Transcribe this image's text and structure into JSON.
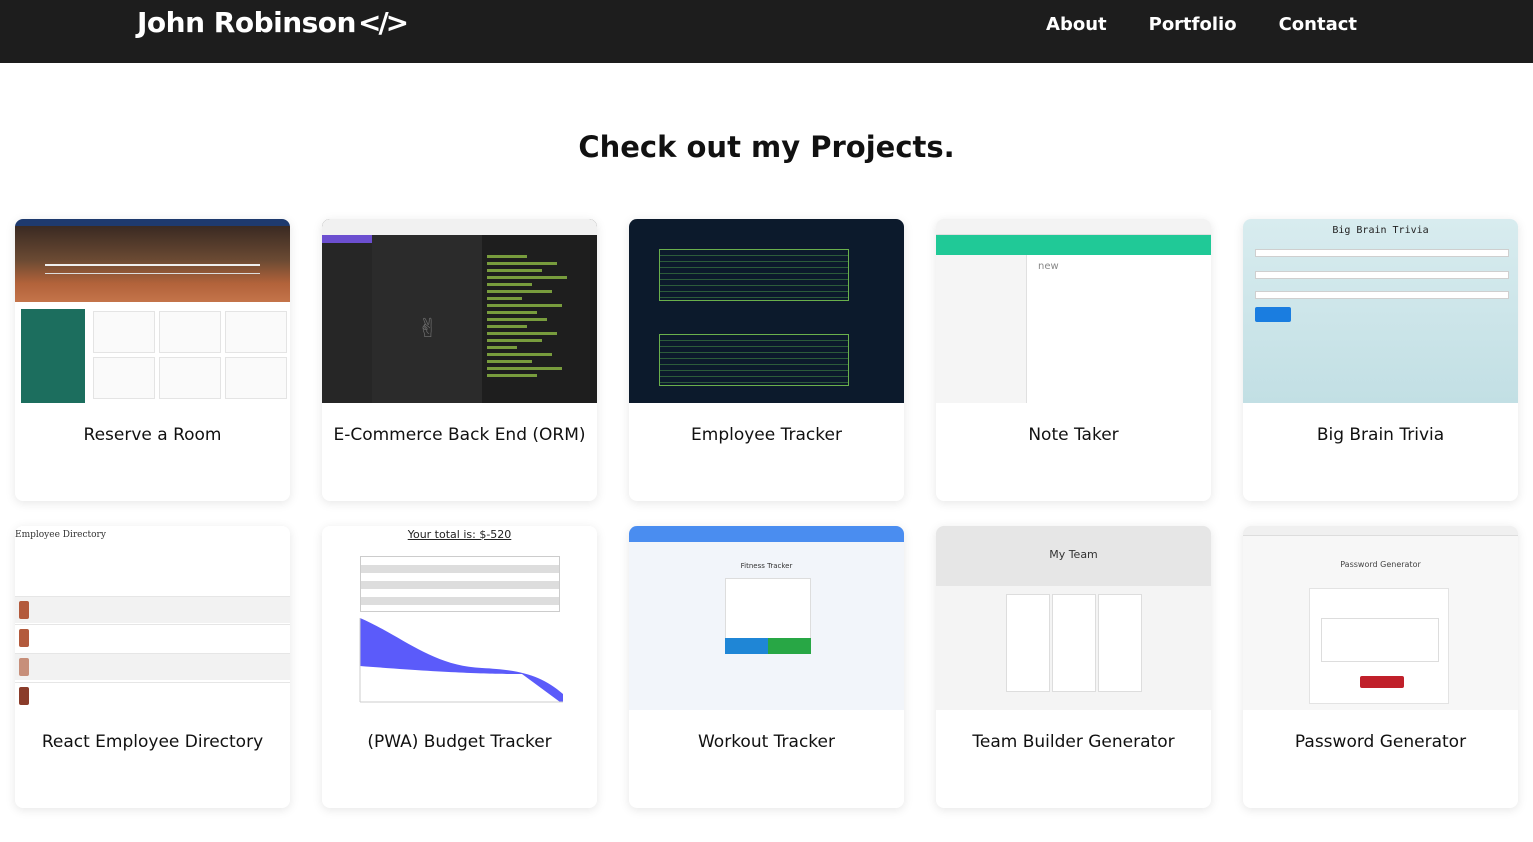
{
  "navbar": {
    "brand": "John Robinson",
    "brand_icon": "code-icon",
    "links": [
      "About",
      "Portfolio",
      "Contact"
    ]
  },
  "heading": "Check out my Projects.",
  "projects": [
    {
      "title": "Reserve a Room",
      "thumbnail": "reserve-a-room-screenshot"
    },
    {
      "title": "E-Commerce Back End (ORM)",
      "thumbnail": "ecommerce-back-end-screenshot"
    },
    {
      "title": "Employee Tracker",
      "thumbnail": "employee-tracker-screenshot"
    },
    {
      "title": "Note Taker",
      "thumbnail": "note-taker-screenshot"
    },
    {
      "title": "Big Brain Trivia",
      "thumbnail": "big-brain-trivia-screenshot"
    },
    {
      "title": "React Employee Directory",
      "thumbnail": "react-employee-directory-screenshot"
    },
    {
      "title": "(PWA) Budget Tracker",
      "thumbnail": "budget-tracker-screenshot"
    },
    {
      "title": "Workout Tracker",
      "thumbnail": "workout-tracker-screenshot"
    },
    {
      "title": "Team Builder Generator",
      "thumbnail": "team-builder-generator-screenshot"
    },
    {
      "title": "Password Generator",
      "thumbnail": "password-generator-screenshot"
    }
  ],
  "thumbnails_text": {
    "note_taker_new": "new",
    "trivia_title": "Big Brain Trivia",
    "budget_total": "Your total is: $-520",
    "directory_title": "Employee Directory",
    "workout_title": "Fitness Tracker",
    "team_title": "My Team",
    "password_title": "Password Generator"
  }
}
